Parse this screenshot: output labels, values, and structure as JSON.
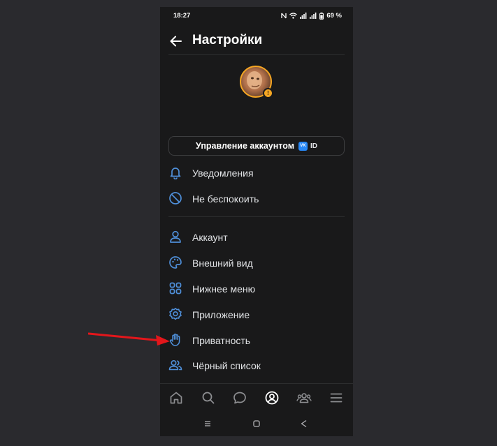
{
  "status_bar": {
    "time": "18:27",
    "battery": "69 %",
    "icons": [
      "nfc-icon",
      "wifi-icon",
      "signal-icon",
      "signal-icon",
      "battery-icon"
    ]
  },
  "header": {
    "title": "Настройки",
    "back_icon": "arrow-left-icon"
  },
  "profile": {
    "avatar_badge": "!"
  },
  "account_button": {
    "label": "Управление аккаунтом",
    "vk_logo_text": "VK",
    "id_text": "ID"
  },
  "menu_group_1": [
    {
      "label": "Уведомления",
      "icon": "bell-icon"
    },
    {
      "label": "Не беспокоить",
      "icon": "do-not-disturb-icon"
    }
  ],
  "menu_group_2": [
    {
      "label": "Аккаунт",
      "icon": "user-icon"
    },
    {
      "label": "Внешний вид",
      "icon": "palette-icon"
    },
    {
      "label": "Нижнее меню",
      "icon": "grid-icon"
    },
    {
      "label": "Приложение",
      "icon": "gear-icon"
    },
    {
      "label": "Приватность",
      "icon": "hand-icon"
    },
    {
      "label": "Чёрный список",
      "icon": "users-icon"
    }
  ],
  "tabbar": [
    "home-icon",
    "search-icon",
    "chat-icon",
    "profile-icon",
    "friends-icon",
    "menu-icon"
  ],
  "system_nav": [
    "recents-icon",
    "home-square-icon",
    "back-triangle-icon"
  ],
  "colors": {
    "background": "#2a2a2e",
    "screen": "#19191a",
    "accent": "#4f8fd9",
    "avatar_ring": "#f5a623",
    "annotation_arrow": "#e3161b"
  }
}
